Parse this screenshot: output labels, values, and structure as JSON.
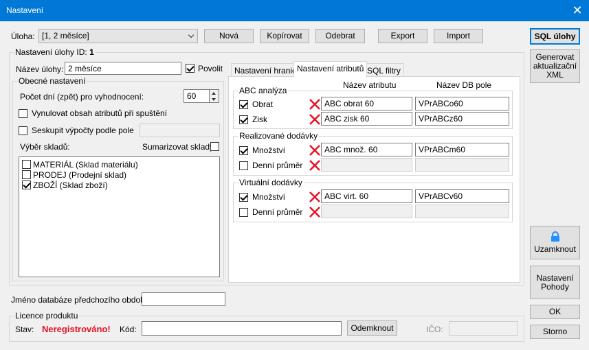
{
  "window": {
    "title": "Nastavení",
    "close_glyph": "✕"
  },
  "task": {
    "label": "Úloha:",
    "value": "[1, 2 měsíce]",
    "buttons": {
      "new": "Nová",
      "copy": "Kopírovat",
      "delete": "Odebrat",
      "export": "Export",
      "import": "Import"
    }
  },
  "right": {
    "sql": "SQL úlohy",
    "gen_line1": "Generovat",
    "gen_line2": "aktualizační",
    "gen_line3": "XML",
    "lock": "Uzamknout",
    "pohoda_line1": "Nastavení",
    "pohoda_line2": "Pohody",
    "ok": "OK",
    "cancel": "Storno"
  },
  "settings": {
    "id_label": "Nastavení úlohy ID:",
    "id_value": "1",
    "name_label": "Název úlohy:",
    "name_value": "2 měsíce",
    "allow_label": "Povolit",
    "general_legend": "Obecné nastavení",
    "days_label": "Počet dní (zpět) pro vyhodnocení:",
    "days_value": "60",
    "reset_label": "Vynulovat obsah atributů při spuštění",
    "group_label": "Seskupit výpočty podle pole",
    "stores_label": "Výběr skladů:",
    "summarize_label": "Sumarizovat sklady",
    "stores": [
      {
        "label": "MATERIÁL (Sklad materiálu)",
        "checked": false
      },
      {
        "label": "PRODEJ (Prodejní sklad)",
        "checked": false
      },
      {
        "label": "ZBOŽÍ (Sklad zboží)",
        "checked": true
      }
    ]
  },
  "tabs": [
    "Nastavení hranic",
    "Nastavení atributů",
    "SQL filtry"
  ],
  "attrs": {
    "col_attr": "Název atributu",
    "col_db": "Název DB pole",
    "abc_legend": "ABC analýza",
    "abc_rows": [
      {
        "label": "Obrat",
        "attr": "ABC obrat 60",
        "db": "VPrABCo60"
      },
      {
        "label": "Zisk",
        "attr": "ABC zisk 60",
        "db": "VPrABCz60"
      }
    ],
    "real_legend": "Realizované dodávky",
    "real_rows": [
      {
        "label": "Množství",
        "attr": "ABC množ. 60",
        "db": "VPrABCm60"
      },
      {
        "label": "Denní průměr",
        "attr": "",
        "db": ""
      }
    ],
    "virt_legend": "Virtuální dodávky",
    "virt_rows": [
      {
        "label": "Množství",
        "attr": "ABC virt. 60",
        "db": "VPrABCv60"
      },
      {
        "label": "Denní průměr",
        "attr": "",
        "db": ""
      }
    ]
  },
  "prev_db_label": "Jméno databáze předchozího období:",
  "license": {
    "legend": "Licence produktu",
    "status_label": "Stav:",
    "status_value": "Neregistrováno!",
    "code_label": "Kód:",
    "unlock": "Odemknout",
    "ico_label": "IČO:"
  }
}
